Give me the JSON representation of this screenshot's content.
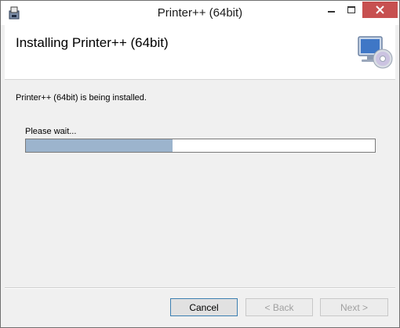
{
  "window": {
    "title": "Printer++ (64bit)"
  },
  "header": {
    "title": "Installing Printer++ (64bit)"
  },
  "main": {
    "status_message": "Printer++ (64bit) is being installed.",
    "wait_label": "Please wait...",
    "progress_fraction": 0.42
  },
  "buttons": {
    "cancel": "Cancel",
    "back": "< Back",
    "next": "Next >"
  },
  "colors": {
    "progress_fill": "#9cb4cd",
    "close_button": "#c75050"
  },
  "icons": {
    "app": "installer-icon",
    "header": "computer-cd-icon"
  }
}
